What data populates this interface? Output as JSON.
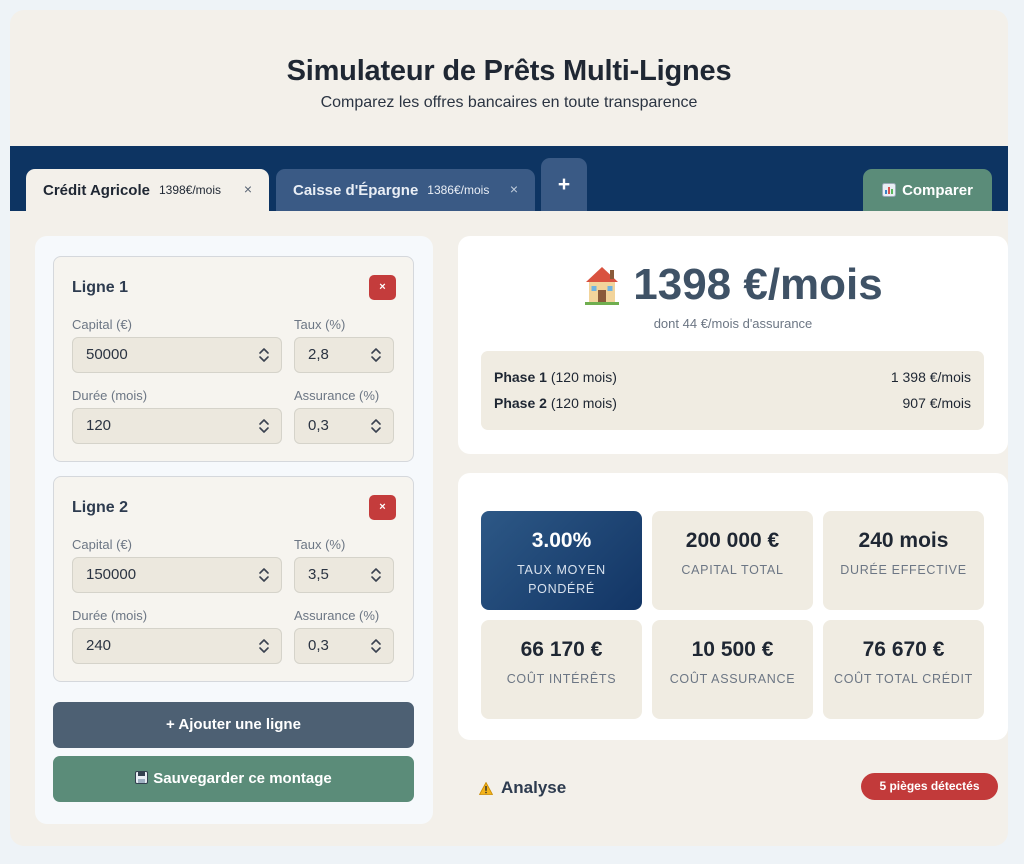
{
  "header": {
    "title": "Simulateur de Prêts Multi-Lignes",
    "subtitle": "Comparez les offres bancaires en toute transparence"
  },
  "tabs": [
    {
      "label": "Crédit Agricole",
      "amount": "1398€/mois",
      "close": "×",
      "active": true
    },
    {
      "label": "Caisse d'Épargne",
      "amount": "1386€/mois",
      "close": "×",
      "active": false
    }
  ],
  "tab_add_label": "+",
  "compare_label": "Comparer",
  "lines": [
    {
      "title": "Ligne 1",
      "delete": "×",
      "capital_label": "Capital (€)",
      "capital": "50000",
      "taux_label": "Taux (%)",
      "taux": "2,8",
      "duree_label": "Durée (mois)",
      "duree": "120",
      "assurance_label": "Assurance (%)",
      "assurance": "0,3"
    },
    {
      "title": "Ligne 2",
      "delete": "×",
      "capital_label": "Capital (€)",
      "capital": "150000",
      "taux_label": "Taux (%)",
      "taux": "3,5",
      "duree_label": "Durée (mois)",
      "duree": "240",
      "assurance_label": "Assurance (%)",
      "assurance": "0,3"
    }
  ],
  "buttons": {
    "add_line": "+ Ajouter une ligne",
    "save": "Sauvegarder ce montage"
  },
  "summary": {
    "monthly": "1398 €/mois",
    "insurance_note": "dont 44 €/mois d'assurance",
    "phases": [
      {
        "name": "Phase 1",
        "duration": "(120 mois)",
        "value": "1 398 €/mois"
      },
      {
        "name": "Phase 2",
        "duration": "(120 mois)",
        "value": "907 €/mois"
      }
    ]
  },
  "stats": [
    {
      "value": "3.00%",
      "label": "TAUX MOYEN PONDÉRÉ",
      "highlight": true
    },
    {
      "value": "200 000 €",
      "label": "CAPITAL TOTAL"
    },
    {
      "value": "240 mois",
      "label": "DURÉE EFFECTIVE"
    },
    {
      "value": "66 170 €",
      "label": "COÛT INTÉRÊTS"
    },
    {
      "value": "10 500 €",
      "label": "COÛT ASSURANCE"
    },
    {
      "value": "76 670 €",
      "label": "COÛT TOTAL CRÉDIT"
    }
  ],
  "analysis": {
    "title": "Analyse",
    "badge": "5 pièges détectés"
  },
  "colors": {
    "tab_bar": "#0d3462",
    "accent_green": "#5b8c79",
    "danger": "#c43c3c",
    "highlight_stat": "#1d4472"
  },
  "icons": [
    "house-icon",
    "chart-icon",
    "floppy-disk-icon",
    "warning-icon",
    "spinner-arrows-icon"
  ]
}
